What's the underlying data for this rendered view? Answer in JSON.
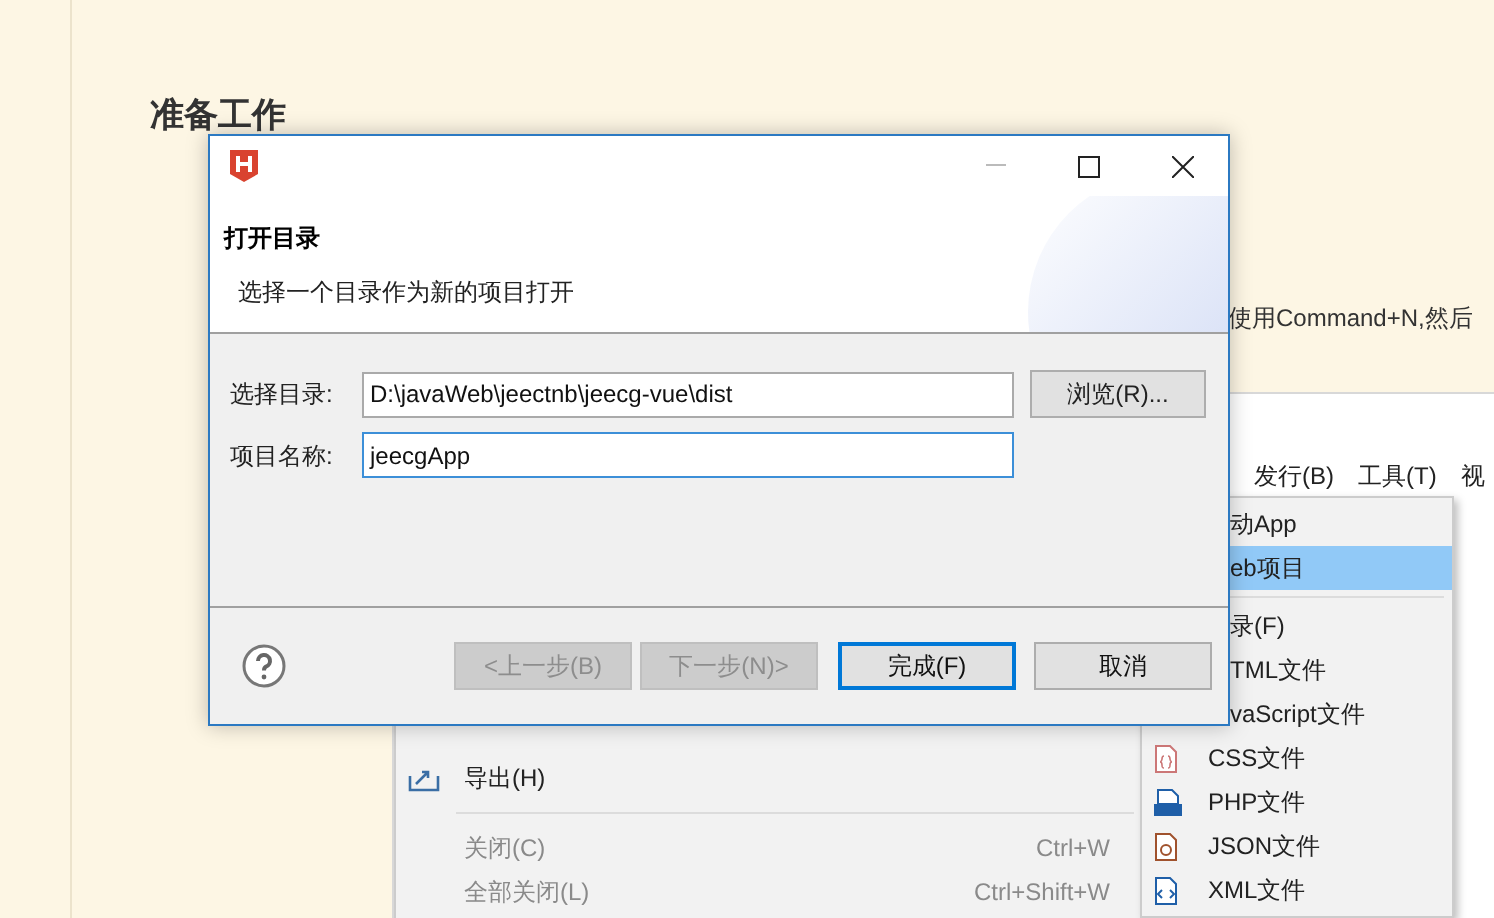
{
  "page": {
    "heading": "准备工作",
    "text_fragment": "使用Command+N,然后"
  },
  "app_window": {
    "menu_bar": [
      {
        "label": "发行(B)"
      },
      {
        "label": "工具(T)"
      },
      {
        "label": "视"
      }
    ],
    "file_menu": [
      {
        "kind": "export",
        "label": "导出(H)",
        "disabled": false
      },
      {
        "kind": "separator"
      },
      {
        "kind": "plain",
        "label": "关闭(C)",
        "shortcut": "Ctrl+W",
        "disabled": true
      },
      {
        "kind": "plain",
        "label": "全部关闭(L)",
        "shortcut": "Ctrl+Shift+W",
        "disabled": true
      }
    ],
    "submenu": [
      {
        "kind": "cut",
        "label": "动App",
        "selected": false
      },
      {
        "kind": "cut",
        "label": "eb项目",
        "selected": true
      },
      {
        "kind": "separator"
      },
      {
        "kind": "cut",
        "label": "录(F)",
        "selected": false
      },
      {
        "kind": "cut",
        "label": "TML文件",
        "selected": false
      },
      {
        "kind": "cut",
        "label": "vaScript文件",
        "selected": false
      },
      {
        "kind": "css",
        "label": "CSS文件",
        "selected": false
      },
      {
        "kind": "php",
        "label": "PHP文件",
        "selected": false
      },
      {
        "kind": "json",
        "label": "JSON文件",
        "selected": false
      },
      {
        "kind": "xml",
        "label": "XML文件",
        "selected": false
      }
    ]
  },
  "dialog": {
    "header": {
      "title": "打开目录",
      "subtitle": "选择一个目录作为新的项目打开"
    },
    "fields": [
      {
        "label": "选择目录:",
        "value": "D:\\javaWeb\\jeectnb\\jeecg-vue\\dist",
        "focused": false
      },
      {
        "label": "项目名称:",
        "value": "jeecgApp",
        "focused": true
      }
    ],
    "browse_button": "浏览(R)...",
    "buttons": [
      {
        "label": "<上一步(B)",
        "disabled": true,
        "default": false
      },
      {
        "label": "下一步(N)>",
        "disabled": true,
        "default": false
      },
      {
        "label": "完成(F)",
        "disabled": false,
        "default": true
      },
      {
        "label": "取消",
        "disabled": false,
        "default": false
      }
    ]
  }
}
